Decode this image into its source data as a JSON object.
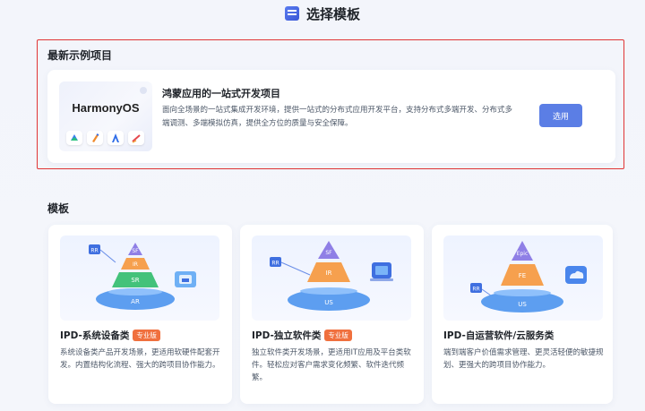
{
  "header": {
    "title": "选择模板",
    "icon": "template-icon"
  },
  "latest": {
    "section_title": "最新示例项目",
    "project": {
      "logo_text": "HarmonyOS",
      "title": "鸿蒙应用的一站式开发项目",
      "description": "面向全场景的一站式集成开发环境，提供一站式的分布式应用开发平台，支持分布式多端开发、分布式多端调测、多端模拟仿真，提供全方位的质量与安全保障。",
      "select_label": "选用",
      "tools": [
        "cloud-icon",
        "pencil-icon",
        "a-tool-icon",
        "pen-icon"
      ]
    }
  },
  "templates": {
    "section_title": "模板",
    "items": [
      {
        "name": "IPD-系统设备类",
        "badge": "专业版",
        "description": "系统设备类产品开发场景，更适用软硬件配套开发。内置结构化流程、强大的跨项目协作能力。",
        "layers": [
          "SF",
          "IR",
          "SR",
          "AR"
        ],
        "side_label": "RR"
      },
      {
        "name": "IPD-独立软件类",
        "badge": "专业版",
        "description": "独立软件类开发场景，更适用IT应用及平台类软件。轻松应对客户需求变化频繁、软件迭代频繁。",
        "layers": [
          "SF",
          "IR",
          "US"
        ],
        "side_label": "RR"
      },
      {
        "name": "IPD-自运营软件/云服务类",
        "badge": "",
        "description": "端到端客户价值需求管理、更灵活轻便的敏捷规划、更强大的跨项目协作能力。",
        "layers": [
          "Epic",
          "FE",
          "US"
        ],
        "side_label": "RR"
      }
    ]
  },
  "colors": {
    "accent": "#5b7ee5",
    "badge": "#f0703e",
    "highlight_border": "#e03535"
  }
}
